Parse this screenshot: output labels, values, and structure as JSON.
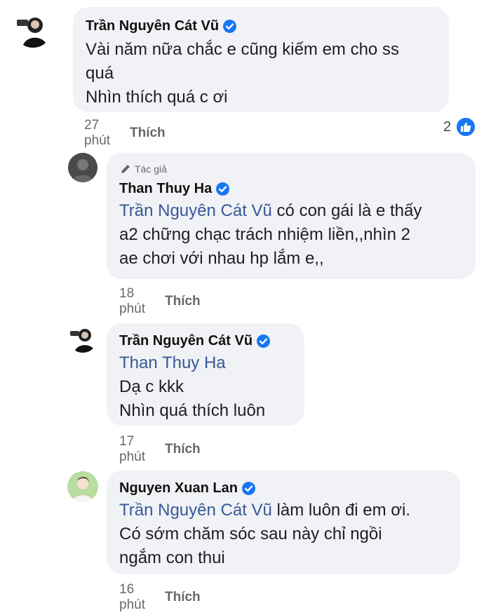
{
  "comments": [
    {
      "author": "Trần Nguyên Cát Vũ",
      "lines": [
        "Vài năm nữa chắc e cũng kiếm em cho ss",
        "quá",
        "Nhìn thích quá c ơi"
      ],
      "time": "27 phút",
      "like_label": "Thích",
      "reaction_count": "2"
    },
    {
      "author_badge": "Tác giả",
      "author": "Than Thuy Ha",
      "mention": "Trần Nguyên Cát Vũ",
      "line1_rest": " có con gái là e thấy",
      "lines": [
        "a2 chững chạc trách nhiệm liền,,nhìn 2",
        "ae chơi với nhau hp lắm e,,"
      ],
      "time": "18 phút",
      "like_label": "Thích"
    },
    {
      "author": "Trần Nguyên Cát Vũ",
      "mention": "Than Thuy Ha",
      "lines": [
        "Dạ c kkk",
        "Nhìn quá thích luôn"
      ],
      "time": "17 phút",
      "like_label": "Thích"
    },
    {
      "author": "Nguyen Xuan Lan",
      "mention": "Trần Nguyên Cát Vũ",
      "line1_rest": " làm luôn đi em ơi.",
      "lines": [
        "Có sớm chăm sóc sau này chỉ ngồi",
        "ngắm con thui"
      ],
      "time": "16 phút",
      "like_label": "Thích"
    }
  ],
  "colors": {
    "bubble": "#f0f2f5",
    "mention": "#385898",
    "verified": "#1877f2",
    "meta": "#65676b"
  },
  "icons": {
    "verified": "verified-badge-icon",
    "author_badge": "pencil-icon",
    "reaction": "thumbs-up-icon"
  }
}
